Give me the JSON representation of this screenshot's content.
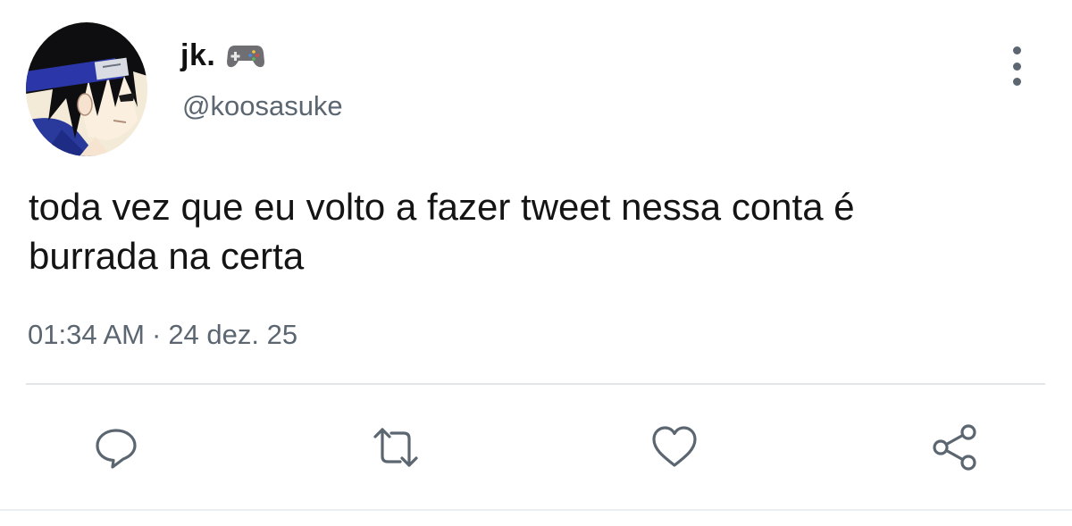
{
  "author": {
    "display_name": "jk.",
    "name_emoji_icon": "gamepad-icon",
    "handle": "@koosasuke"
  },
  "tweet": {
    "text_line_1": "toda vez que eu volto a fazer tweet nessa conta é",
    "text_line_2": "burrada na certa"
  },
  "meta": {
    "time": "01:34 AM",
    "separator": "·",
    "date": "24 dez. 25"
  },
  "actions": [
    {
      "icon": "reply-icon"
    },
    {
      "icon": "retweet-icon"
    },
    {
      "icon": "like-icon"
    },
    {
      "icon": "share-icon"
    }
  ],
  "colors": {
    "secondary_text": "#5b6670",
    "primary_text": "#141414",
    "divider": "#e3e6e8"
  }
}
